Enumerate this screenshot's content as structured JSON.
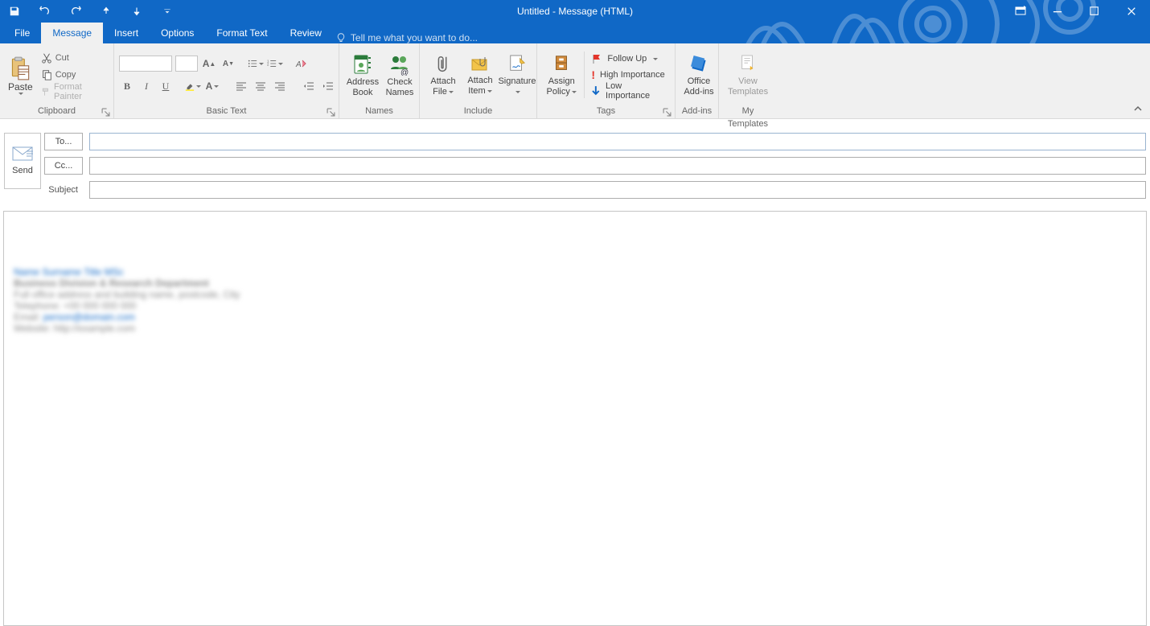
{
  "title": "Untitled - Message (HTML)",
  "tabs": {
    "file": "File",
    "message": "Message",
    "insert": "Insert",
    "options": "Options",
    "format": "Format Text",
    "review": "Review",
    "tell": "Tell me what you want to do..."
  },
  "ribbon": {
    "clipboard": {
      "paste": "Paste",
      "cut": "Cut",
      "copy": "Copy",
      "painter": "Format Painter",
      "label": "Clipboard"
    },
    "basic": {
      "label": "Basic Text"
    },
    "names": {
      "address": "Address\nBook",
      "check": "Check\nNames",
      "label": "Names"
    },
    "include": {
      "attachfile": "Attach\nFile",
      "attachitem": "Attach\nItem",
      "signature": "Signature",
      "label": "Include"
    },
    "assign": {
      "btn": "Assign\nPolicy"
    },
    "tags": {
      "follow": "Follow Up",
      "high": "High Importance",
      "low": "Low Importance",
      "label": "Tags"
    },
    "addins": {
      "btn": "Office\nAdd-ins",
      "label": "Add-ins"
    },
    "templates": {
      "btn": "View\nTemplates",
      "label": "My Templates"
    }
  },
  "compose": {
    "send": "Send",
    "to": "To...",
    "cc": "Cc...",
    "subject": "Subject",
    "to_val": "",
    "cc_val": "",
    "subject_val": ""
  },
  "signature": {
    "l1": "Name Surname Title MSc",
    "l2": "Business Division & Research Department",
    "l3": "Full office address and building name, postcode, City",
    "l4": "Telephone: +00 000 000 000",
    "l5a": "Email: ",
    "l5b": "person@domain.com",
    "l6": "Website: http://example.com"
  }
}
